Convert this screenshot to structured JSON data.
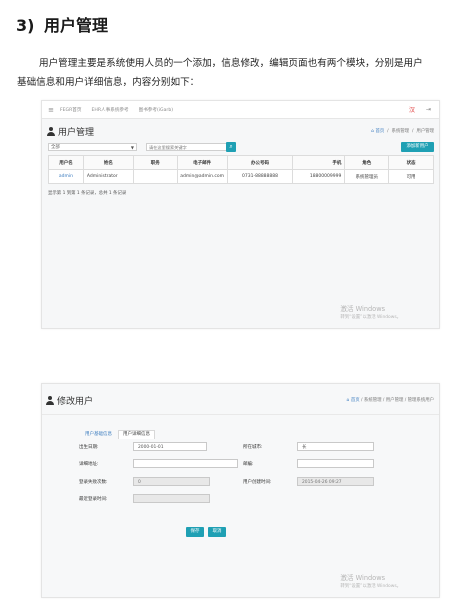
{
  "section": {
    "number": "3)",
    "title": "用户管理"
  },
  "intro": {
    "line1": "用户管理主要是系统使用人员的一个添加，信息修改，编辑页面也有两个模块，分别是用户",
    "line2": "基础信息和用户详细信息，内容分别如下："
  },
  "list_screen": {
    "navbar": {
      "menu_icon": "≡",
      "links": [
        "FEGR首页",
        "EHR人事系统参考",
        "图书参考(iGarb)"
      ],
      "lang_icon": "汉",
      "exit_icon": "⇥"
    },
    "title": "用户管理",
    "breadcrumb": {
      "home": "首页",
      "items": [
        "系统管理",
        "用户管理"
      ]
    },
    "filter": {
      "select_value": "全部",
      "search_placeholder": "请在这里搜索关键字",
      "search_icon": "⌕",
      "add_button": "添加新用户"
    },
    "table": {
      "headers": [
        "用户名",
        "姓名",
        "职务",
        "电子邮件",
        "办公号码",
        "手机",
        "角色",
        "状态"
      ],
      "rows": [
        [
          "admin",
          "Administrator",
          "",
          "admin@admin.com",
          "0731-88888888",
          "18800009999",
          "系统管理员",
          "可用"
        ]
      ]
    },
    "pagination": "显示第 1 到第 1 条记录，总共 1 条记录",
    "watermark": {
      "title": "激活 Windows",
      "subtitle": "转到“设置”以激活 Windows。"
    }
  },
  "edit_screen": {
    "title": "修改用户",
    "breadcrumb": {
      "home": "首页",
      "items": [
        "系统管理",
        "用户管理",
        "管理系统用户"
      ]
    },
    "tabs": [
      "用户基础信息",
      "用户详细信息"
    ],
    "fields": {
      "birth_label": "出生日期:",
      "birth_value": "2000-01-01",
      "city_label": "所在城市:",
      "city_value": "长",
      "address_label": "详细地址:",
      "address_value": "",
      "email_label": "邮编:",
      "email_value": "",
      "login_count_label": "登录失败次数:",
      "login_count_value": "0",
      "created_label": "用户创建时间:",
      "created_value": "2015-04-26 09:27",
      "last_login_label": "最近登录时间:",
      "last_login_value": ""
    },
    "buttons": {
      "save": "保存",
      "cancel": "取消"
    },
    "watermark": {
      "title": "激活 Windows",
      "subtitle": "转到“设置”以激活 Windows。"
    }
  }
}
